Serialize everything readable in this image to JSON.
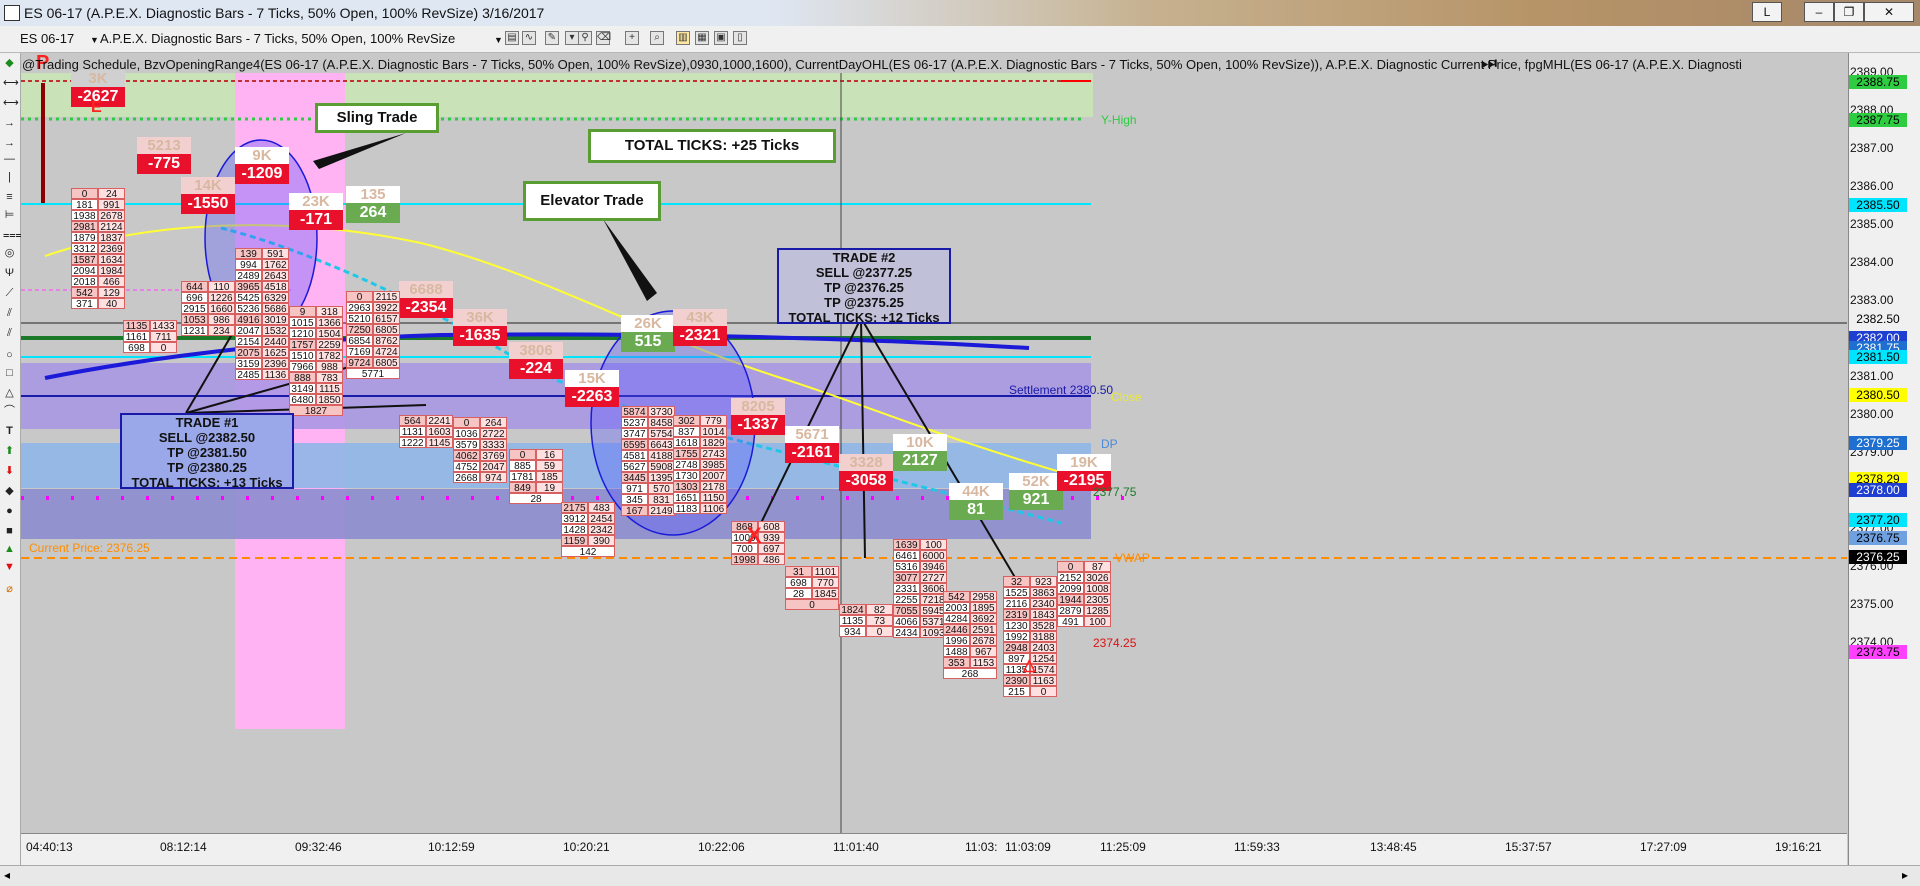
{
  "window": {
    "title": "ES 06-17 (A.P.E.X. Diagnostic Bars - 7 Ticks, 50% Open, 100% RevSize)  3/16/2017",
    "buttons": {
      "link": "L",
      "minimize": "–",
      "restore": "❐",
      "close": "✕"
    }
  },
  "toolbar": {
    "instrument": "ES 06-17",
    "bar_type": "A.P.E.X. Diagnostic Bars - 7 Ticks, 50% Open, 100% RevSize"
  },
  "legend": "@Trading Schedule, BzvOpeningRange4(ES 06-17 (A.P.E.X. Diagnostic Bars - 7 Ticks, 50% Open, 100% RevSize),0930,1000,1600), CurrentDayOHL(ES 06-17 (A.P.E.X. Diagnostic Bars - 7 Ticks, 50% Open, 100% RevSize)), A.P.E.X. Diagnostic Current Price, fpgMHL(ES 06-17 (A.P.E.X. Diagnosti",
  "annotations": {
    "sling": "Sling Trade",
    "elevator": "Elevator Trade",
    "total": "TOTAL TICKS: +25 Ticks",
    "trade1": [
      "TRADE #1",
      "SELL @2382.50",
      "TP @2381.50",
      "TP @2380.25",
      "TOTAL TICKS: +13 Ticks"
    ],
    "trade2": [
      "TRADE #2",
      "SELL @2377.25",
      "TP @2376.25",
      "TP @2375.25",
      "TOTAL TICKS: +12 Ticks"
    ]
  },
  "chart_labels": {
    "y_high": "Y-High",
    "settlement": "Settlement 2380.50",
    "close": "Close",
    "dp": "DP",
    "current_price": "Current Price: 2376.25",
    "vwap": "VWAP",
    "low_mark": "2374.25",
    "level_2377": "2377.75",
    "marker_p": "P",
    "marker_e": "E",
    "marker_x": "X"
  },
  "price_axis": {
    "ticks": [
      "2389.00",
      "2388.00",
      "2387.00",
      "2386.00",
      "2385.00",
      "2384.00",
      "2383.00",
      "2382.00",
      "2381.00",
      "2380.00",
      "2379.00",
      "2378.00",
      "2377.00",
      "2376.00",
      "2375.00",
      "2374.00"
    ],
    "badges": [
      {
        "text": "2388.75",
        "bg": "#2ecc40",
        "fg": "#000"
      },
      {
        "text": "2387.75",
        "bg": "#2ecc40",
        "fg": "#000"
      },
      {
        "text": "2385.50",
        "bg": "#00e5ff",
        "fg": "#000"
      },
      {
        "text": "2382.50",
        "bg": "#f0f0f0",
        "fg": "#000"
      },
      {
        "text": "2382.00",
        "bg": "#1f3fd1",
        "fg": "#fff"
      },
      {
        "text": "2381.75",
        "bg": "#1f6fd1",
        "fg": "#fff"
      },
      {
        "text": "2381.50",
        "bg": "#00e5ff",
        "fg": "#000"
      },
      {
        "text": "2380.50",
        "bg": "#ffff00",
        "fg": "#000"
      },
      {
        "text": "2379.25",
        "bg": "#1f6fd1",
        "fg": "#fff"
      },
      {
        "text": "2378.29",
        "bg": "#ffff00",
        "fg": "#000"
      },
      {
        "text": "2378.00",
        "bg": "#1f3fd1",
        "fg": "#fff"
      },
      {
        "text": "2377.20",
        "bg": "#00e5ff",
        "fg": "#000"
      },
      {
        "text": "2376.75",
        "bg": "#6fa0e0",
        "fg": "#000"
      },
      {
        "text": "2376.25",
        "bg": "#000000",
        "fg": "#fff"
      },
      {
        "text": "2373.75",
        "bg": "#ff40ff",
        "fg": "#000"
      }
    ]
  },
  "time_axis": [
    "04:40:13",
    "08:12:14",
    "09:32:46",
    "10:12:59",
    "10:20:21",
    "10:22:06",
    "11:01:40",
    "11:03:",
    "11:03:09",
    "11:25:09",
    "11:59:33",
    "13:48:45",
    "15:37:57",
    "17:27:09",
    "19:16:21"
  ],
  "bars": [
    {
      "vol": "3K",
      "delta": "-2627",
      "vcolor": "#d0d0d0"
    },
    {
      "vol": "5213",
      "delta": "-775",
      "vcolor": "#f2d0d0"
    },
    {
      "vol": "14K",
      "delta": "-1550",
      "vcolor": "#f2d0d0"
    },
    {
      "vol": "9K",
      "delta": "-1209",
      "vcolor": "#ffffff"
    },
    {
      "vol": "23K",
      "delta": "-171",
      "vcolor": "#ffffff"
    },
    {
      "vol": "135",
      "delta": "264",
      "vcolor": "#ffffff"
    },
    {
      "vol": "6688",
      "delta": "-2354",
      "vcolor": "#f2d0d0"
    },
    {
      "vol": "36K",
      "delta": "-1635",
      "vcolor": "#f2d0d0"
    },
    {
      "vol": "3806",
      "delta": "-224",
      "vcolor": "#f2d0d0"
    },
    {
      "vol": "15K",
      "delta": "-2263",
      "vcolor": "#ffffff"
    },
    {
      "vol": "26K",
      "delta": "515",
      "vcolor": "#ffffff"
    },
    {
      "vol": "43K",
      "delta": "-2321",
      "vcolor": "#f2d0d0"
    },
    {
      "vol": "8205",
      "delta": "-1337",
      "vcolor": "#f2d0d0"
    },
    {
      "vol": "5671",
      "delta": "-2161",
      "vcolor": "#ffffff"
    },
    {
      "vol": "3328",
      "delta": "-3058",
      "vcolor": "#f2d0d0"
    },
    {
      "vol": "10K",
      "delta": "2127",
      "vcolor": "#ffffff"
    },
    {
      "vol": "44K",
      "delta": "81",
      "vcolor": "#ffffff"
    },
    {
      "vol": "52K",
      "delta": "921",
      "vcolor": "#ffffff"
    },
    {
      "vol": "19K",
      "delta": "-2195",
      "vcolor": "#ffffff"
    }
  ],
  "footprint": [
    {
      "cells": [
        "0",
        "24",
        "181",
        "991",
        "1938",
        "2678",
        "2981",
        "2124",
        "1879",
        "1837",
        "3312",
        "2369",
        "1587",
        "1634",
        "2094",
        "1984",
        "2018",
        "466",
        "542",
        "129",
        "371",
        "40"
      ]
    },
    {
      "cells": [
        "1135",
        "1433",
        "1161",
        "711",
        "698",
        "0"
      ]
    },
    {
      "cells": [
        "644",
        "110",
        "696",
        "1226",
        "2915",
        "1660",
        "1053",
        "986",
        "1231",
        "234"
      ]
    },
    {
      "cells": [
        "139",
        "591",
        "994",
        "1762",
        "2489",
        "2643",
        "3965",
        "4518",
        "5425",
        "6329",
        "5236",
        "5686",
        "4916",
        "3019",
        "2047",
        "1532",
        "2154",
        "2440",
        "2075",
        "1625",
        "3159",
        "2396",
        "2485",
        "1136"
      ]
    },
    {
      "cells": [
        "9",
        "318",
        "1015",
        "1366",
        "1210",
        "1504",
        "1757",
        "2259",
        "1510",
        "1782",
        "7966",
        "988",
        "888",
        "783",
        "3149",
        "1115",
        "6480",
        "1850",
        "1827"
      ]
    },
    {
      "cells": [
        "0",
        "2115",
        "2963",
        "3922",
        "5210",
        "6157",
        "7250",
        "6805",
        "6854",
        "8762",
        "7169",
        "4724",
        "9724",
        "6805",
        "5771"
      ]
    },
    {
      "cells": [
        "564",
        "2241",
        "1131",
        "1603",
        "1222",
        "1145"
      ]
    },
    {
      "cells": [
        "0",
        "264",
        "1036",
        "2722",
        "3579",
        "3333",
        "4062",
        "3769",
        "4752",
        "2047",
        "2668",
        "974"
      ]
    },
    {
      "cells": [
        "0",
        "16",
        "885",
        "59",
        "1781",
        "185",
        "849",
        "19",
        "28"
      ]
    },
    {
      "cells": [
        "2175",
        "483",
        "3912",
        "2454",
        "1428",
        "2342",
        "1159",
        "390",
        "142"
      ]
    },
    {
      "cells": [
        "5874",
        "3730",
        "5237",
        "8458",
        "3747",
        "5754",
        "6595",
        "6643",
        "4581",
        "4188",
        "5627",
        "5908",
        "3445",
        "1395",
        "971",
        "570",
        "345",
        "831",
        "167",
        "2149"
      ]
    },
    {
      "cells": [
        "302",
        "779",
        "837",
        "1014",
        "1618",
        "1829",
        "1755",
        "2743",
        "2748",
        "3985",
        "1730",
        "2007",
        "1303",
        "2178",
        "1651",
        "1150",
        "1183",
        "1106"
      ]
    },
    {
      "cells": [
        "868",
        "608",
        "1009",
        "939",
        "700",
        "697",
        "1998",
        "486"
      ]
    },
    {
      "cells": [
        "31",
        "1101",
        "698",
        "770",
        "28",
        "1845",
        "0"
      ]
    },
    {
      "cells": [
        "1824",
        "82",
        "1135",
        "73",
        "934",
        "0"
      ]
    },
    {
      "cells": [
        "1639",
        "100",
        "6461",
        "6000",
        "5316",
        "3946",
        "3077",
        "2727",
        "2331",
        "3606",
        "2255",
        "7218",
        "7055",
        "5945",
        "4066",
        "5371",
        "2434",
        "1093"
      ]
    },
    {
      "cells": [
        "542",
        "2958",
        "2003",
        "1895",
        "4284",
        "3692",
        "2446",
        "2591",
        "1996",
        "2678",
        "1488",
        "967",
        "353",
        "1153",
        "268"
      ]
    },
    {
      "cells": [
        "32",
        "923",
        "1525",
        "3863",
        "2116",
        "2340",
        "2319",
        "1843",
        "1230",
        "3528",
        "1992",
        "3188",
        "2948",
        "2403",
        "897",
        "1254",
        "1135",
        "1574",
        "2390",
        "1163",
        "215",
        "0"
      ]
    },
    {
      "cells": [
        "0",
        "87",
        "2152",
        "3026",
        "2099",
        "1008",
        "1944",
        "2305",
        "2879",
        "1285",
        "491",
        "100"
      ]
    }
  ]
}
